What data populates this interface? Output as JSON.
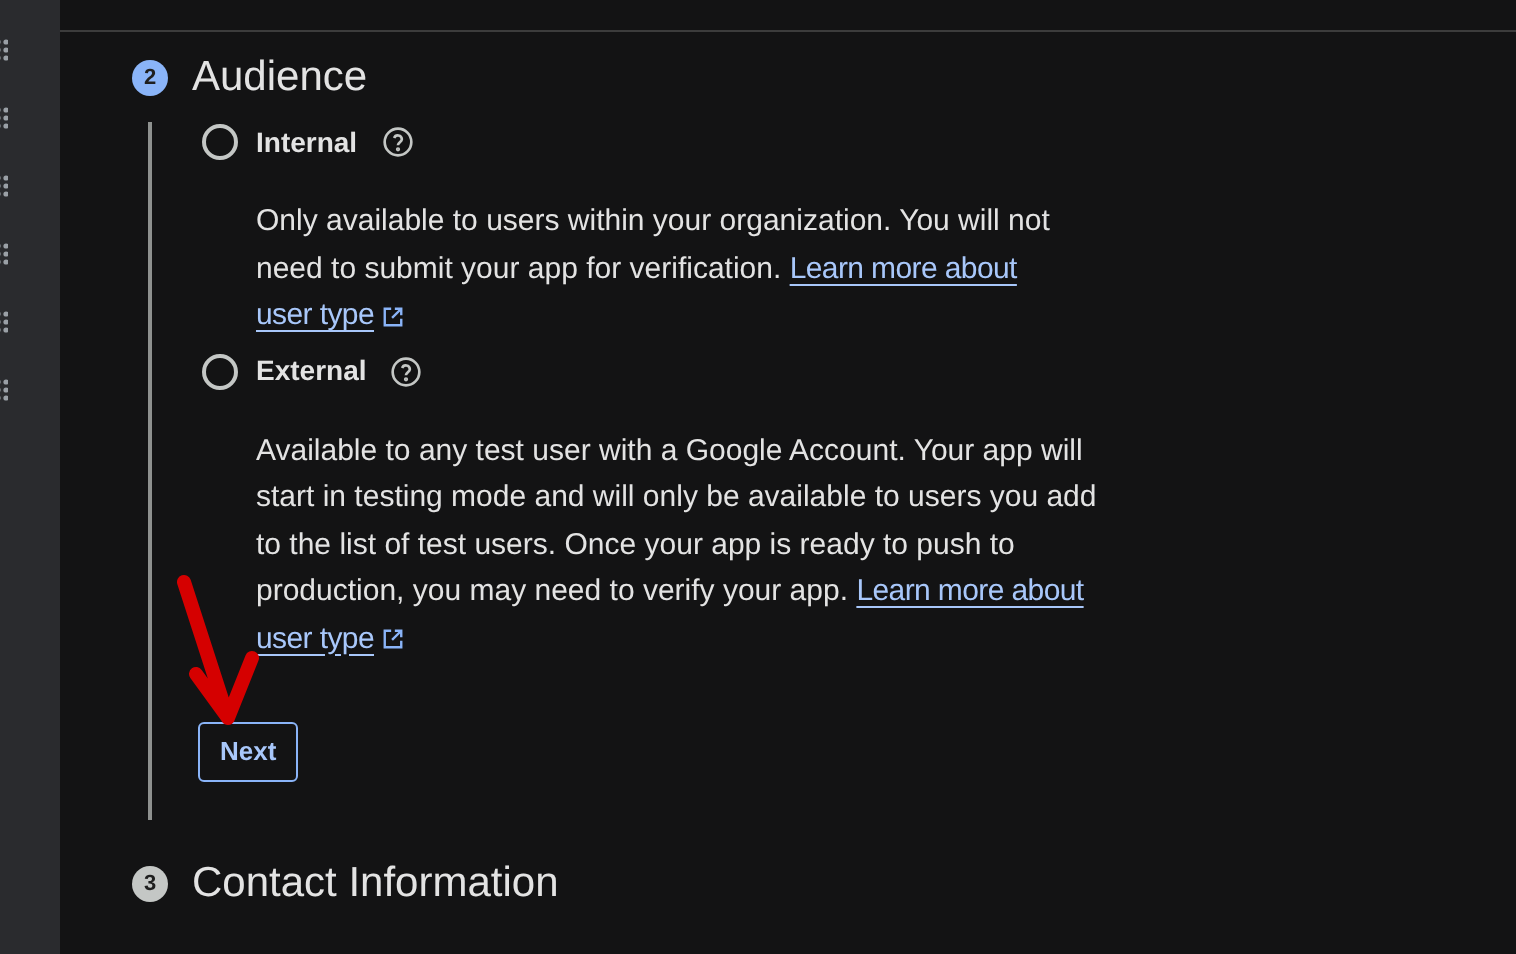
{
  "steps": [
    {
      "number": "2",
      "title": "Audience",
      "selected": true,
      "options": [
        {
          "label": "Internal",
          "selected": false,
          "description": "Only available to users within your organization. You will not need to submit your app for verification.",
          "link": [
            "Learn more about",
            "user type"
          ]
        },
        {
          "label": "External",
          "selected": false,
          "description": "Available to any test user with a Google Account. Your app will start in testing mode and will only be available to users you add to the list of test users. Once your app is ready to push to production, you may need to verify your app.",
          "link": [
            "Learn more about",
            "user type"
          ]
        }
      ],
      "button": "Next"
    },
    {
      "number": "3",
      "title": "Contact Information",
      "selected": false
    }
  ]
}
